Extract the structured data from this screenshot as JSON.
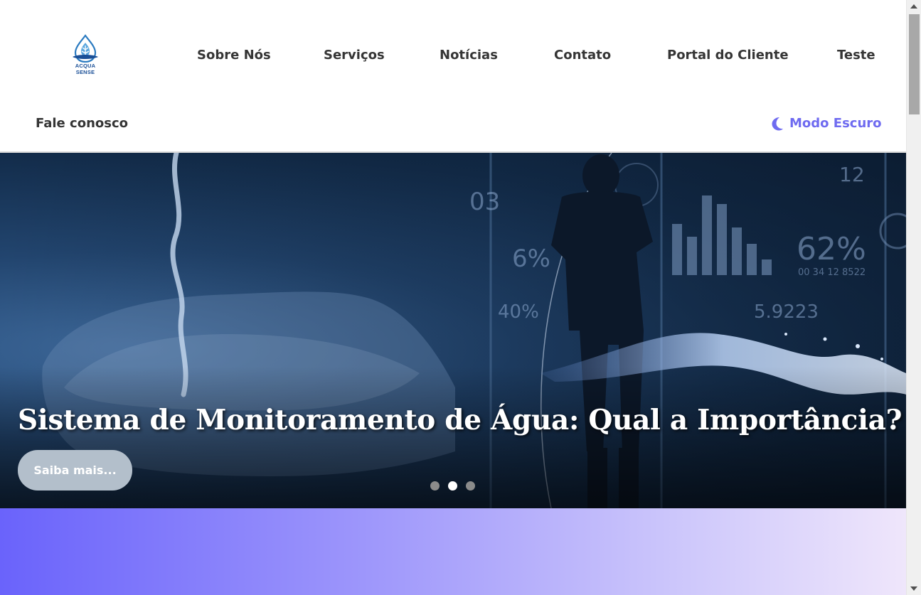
{
  "logo": {
    "text": "ACQUA SENSE"
  },
  "nav": {
    "links": [
      "Sobre Nós",
      "Serviços",
      "Notícias",
      "Contato",
      "Portal do Cliente",
      "Teste"
    ],
    "contact_link": "Fale conosco",
    "dark_mode_label": "Modo Escuro"
  },
  "hero": {
    "title": "Sistema de Monitoramento de Água: Qual a Importância?",
    "button_label": "Saiba mais...",
    "carousel": {
      "slide_count": 3,
      "active_index": 1
    }
  },
  "colors": {
    "accent": "#6f6bf0",
    "nav_text": "#353535",
    "band_start": "#6a63fb",
    "band_end": "#efe6fb"
  },
  "icons": [
    "water-drop-logo-icon",
    "moon-icon"
  ]
}
